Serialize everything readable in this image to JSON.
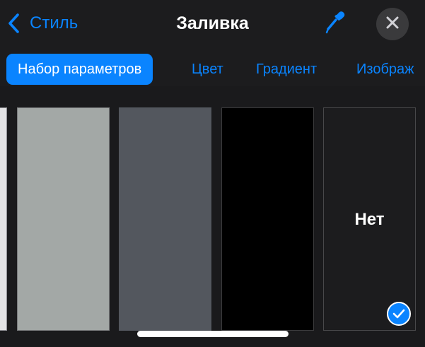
{
  "header": {
    "back_label": "Стиль",
    "title": "Заливка"
  },
  "tabs": [
    {
      "label": "Набор параметров",
      "active": true
    },
    {
      "label": "Цвет",
      "active": false
    },
    {
      "label": "Градиент",
      "active": false
    },
    {
      "label": "Изображ",
      "active": false
    }
  ],
  "swatches": {
    "none_label": "Нет",
    "selected": "none"
  },
  "colors": {
    "accent": "#0a84ff",
    "background": "#1c1c1e",
    "swatch_partial": "#e3e3e5",
    "swatch_light_gray": "#a3a8a6",
    "swatch_dark_gray": "#53575e",
    "swatch_black": "#000000"
  },
  "icons": {
    "back": "chevron-left-icon",
    "eyedropper": "eyedropper-icon",
    "close": "close-icon",
    "selected": "checkmark-icon"
  }
}
